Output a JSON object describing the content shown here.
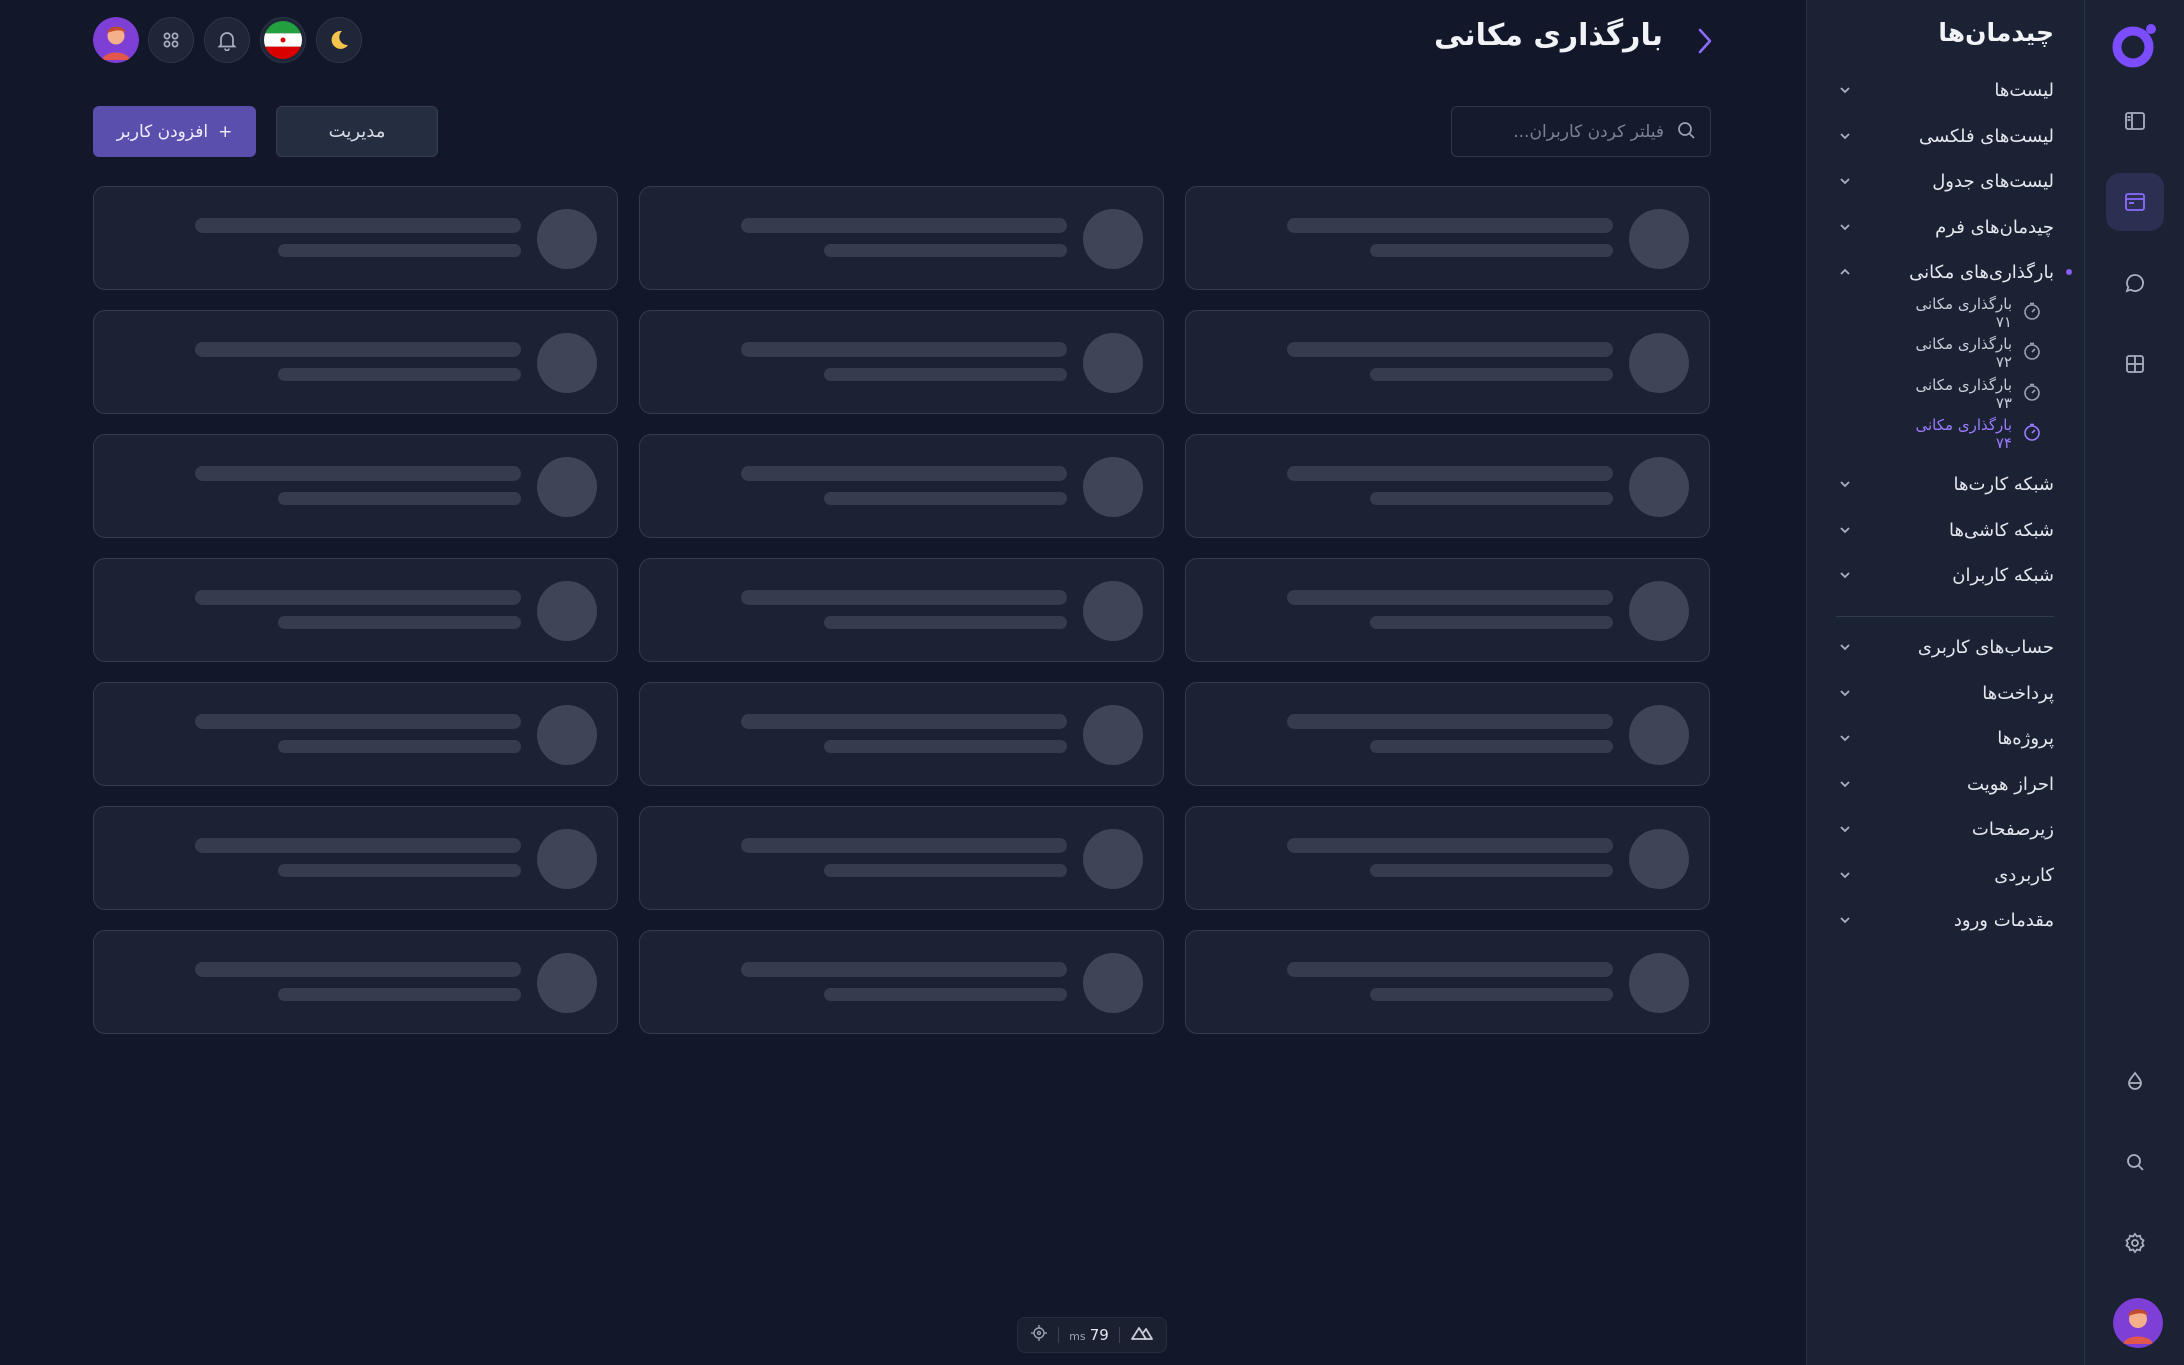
{
  "header": {
    "title": "بارگذاری مکانی",
    "back_icon": "chevron-right-icon"
  },
  "topbar": {
    "icons": [
      "user-avatar",
      "apps-grid-icon",
      "bell-icon",
      "iran-flag-icon",
      "moon-icon"
    ]
  },
  "toolbar": {
    "search_placeholder": "فیلتر کردن کاربران...",
    "manage_label": "مدیریت",
    "add_label": "افزودن کاربر",
    "add_icon": "+"
  },
  "menu": {
    "title": "چیدمان‌ها",
    "items": [
      {
        "label": "لیست‌ها",
        "expanded": false
      },
      {
        "label": "لیست‌های فلکسی",
        "expanded": false
      },
      {
        "label": "لیست‌های جدول",
        "expanded": false
      },
      {
        "label": "چیدمان‌های فرم",
        "expanded": false
      },
      {
        "label": "بارگذاری‌های مکانی",
        "expanded": true
      }
    ],
    "sub_items": [
      {
        "label": "بارگذاری مکانی ۷۱",
        "active": false
      },
      {
        "label": "بارگذاری مکانی ۷۲",
        "active": false
      },
      {
        "label": "بارگذاری مکانی ۷۳",
        "active": false
      },
      {
        "label": "بارگذاری مکانی ۷۴",
        "active": true
      }
    ],
    "items_after": [
      {
        "label": "شبکه کارت‌ها"
      },
      {
        "label": "شبکه کاشی‌ها"
      },
      {
        "label": "شبکه کاربران"
      }
    ],
    "section2": [
      {
        "label": "حساب‌های کاربری"
      },
      {
        "label": "پرداخت‌ها"
      },
      {
        "label": "پروژه‌ها"
      },
      {
        "label": "احراز هویت"
      },
      {
        "label": "زیرصفحات"
      },
      {
        "label": "کاربردی"
      },
      {
        "label": "مقدمات ورود"
      }
    ]
  },
  "rail": {
    "icons": [
      "logo-icon",
      "sidebar-icon",
      "layout-icon",
      "chat-icon",
      "grid-icon",
      "drop-icon",
      "search-icon",
      "gear-icon",
      "user-avatar"
    ],
    "active": "layout-icon"
  },
  "grid": {
    "columns": 3,
    "rows": 7,
    "state": "loading-skeleton"
  },
  "devbar": {
    "ms_value": "79",
    "ms_unit": "ms"
  },
  "colors": {
    "background": "#121729",
    "panel": "#1b2233",
    "accent": "#8b5cf6",
    "primary_button": "#5b4fae"
  }
}
